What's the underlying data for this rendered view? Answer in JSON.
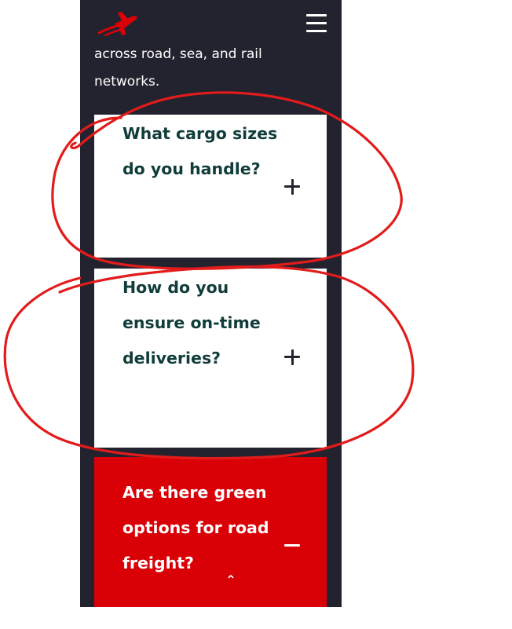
{
  "intro_text": "across road, sea, and rail networks.",
  "faq": [
    {
      "question": "What cargo sizes do you handle?",
      "state": "collapsed",
      "icon": "plus-icon"
    },
    {
      "question": "How do you ensure on-time deliveries?",
      "state": "collapsed",
      "icon": "plus-icon"
    },
    {
      "question": "Are there green options for road freight?",
      "state": "expanded",
      "icon": "minus-icon"
    }
  ],
  "icons": {
    "logo": "airplane-logo",
    "menu": "hamburger-menu-icon",
    "scroll_top": "chevron-up-icon"
  },
  "colors": {
    "page_background": "#232330",
    "card_background": "#ffffff",
    "question_text": "#103c3a",
    "accent_red": "#d90006",
    "annotation_red": "#e21b1b"
  }
}
